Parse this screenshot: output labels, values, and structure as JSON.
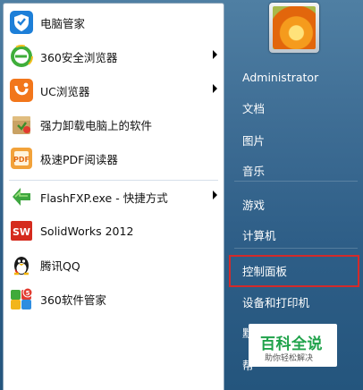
{
  "left_items": [
    {
      "label": "电脑管家",
      "icon": "tencent-pc-manager-icon",
      "has_submenu": false
    },
    {
      "label": "360安全浏览器",
      "icon": "360-browser-icon",
      "has_submenu": true
    },
    {
      "label": "UC浏览器",
      "icon": "uc-browser-icon",
      "has_submenu": true
    },
    {
      "label": "强力卸载电脑上的软件",
      "icon": "uninstaller-icon",
      "has_submenu": false
    },
    {
      "label": "极速PDF阅读器",
      "icon": "pdf-reader-icon",
      "has_submenu": false
    },
    {
      "label": "FlashFXP.exe - 快捷方式",
      "icon": "flashfxp-icon",
      "has_submenu": true
    },
    {
      "label": "SolidWorks 2012",
      "icon": "solidworks-icon",
      "has_submenu": false
    },
    {
      "label": "腾讯QQ",
      "icon": "qq-penguin-icon",
      "has_submenu": false
    },
    {
      "label": "360软件管家",
      "icon": "360-software-manager-icon",
      "has_submenu": false
    }
  ],
  "right_items": [
    {
      "label": "Administrator"
    },
    {
      "label": "文档"
    },
    {
      "label": "图片"
    },
    {
      "label": "音乐"
    },
    {
      "label": "游戏"
    },
    {
      "label": "计算机"
    },
    {
      "label": "控制面板"
    },
    {
      "label": "设备和打印机"
    },
    {
      "label": "默"
    },
    {
      "label": "帮"
    }
  ],
  "watermark": {
    "main": "百科全说",
    "sub": "助你轻松解决"
  },
  "colors": {
    "highlight": "#d42a2a",
    "menu_bg": "#2f5f88",
    "watermark_green": "#1fa24a"
  }
}
